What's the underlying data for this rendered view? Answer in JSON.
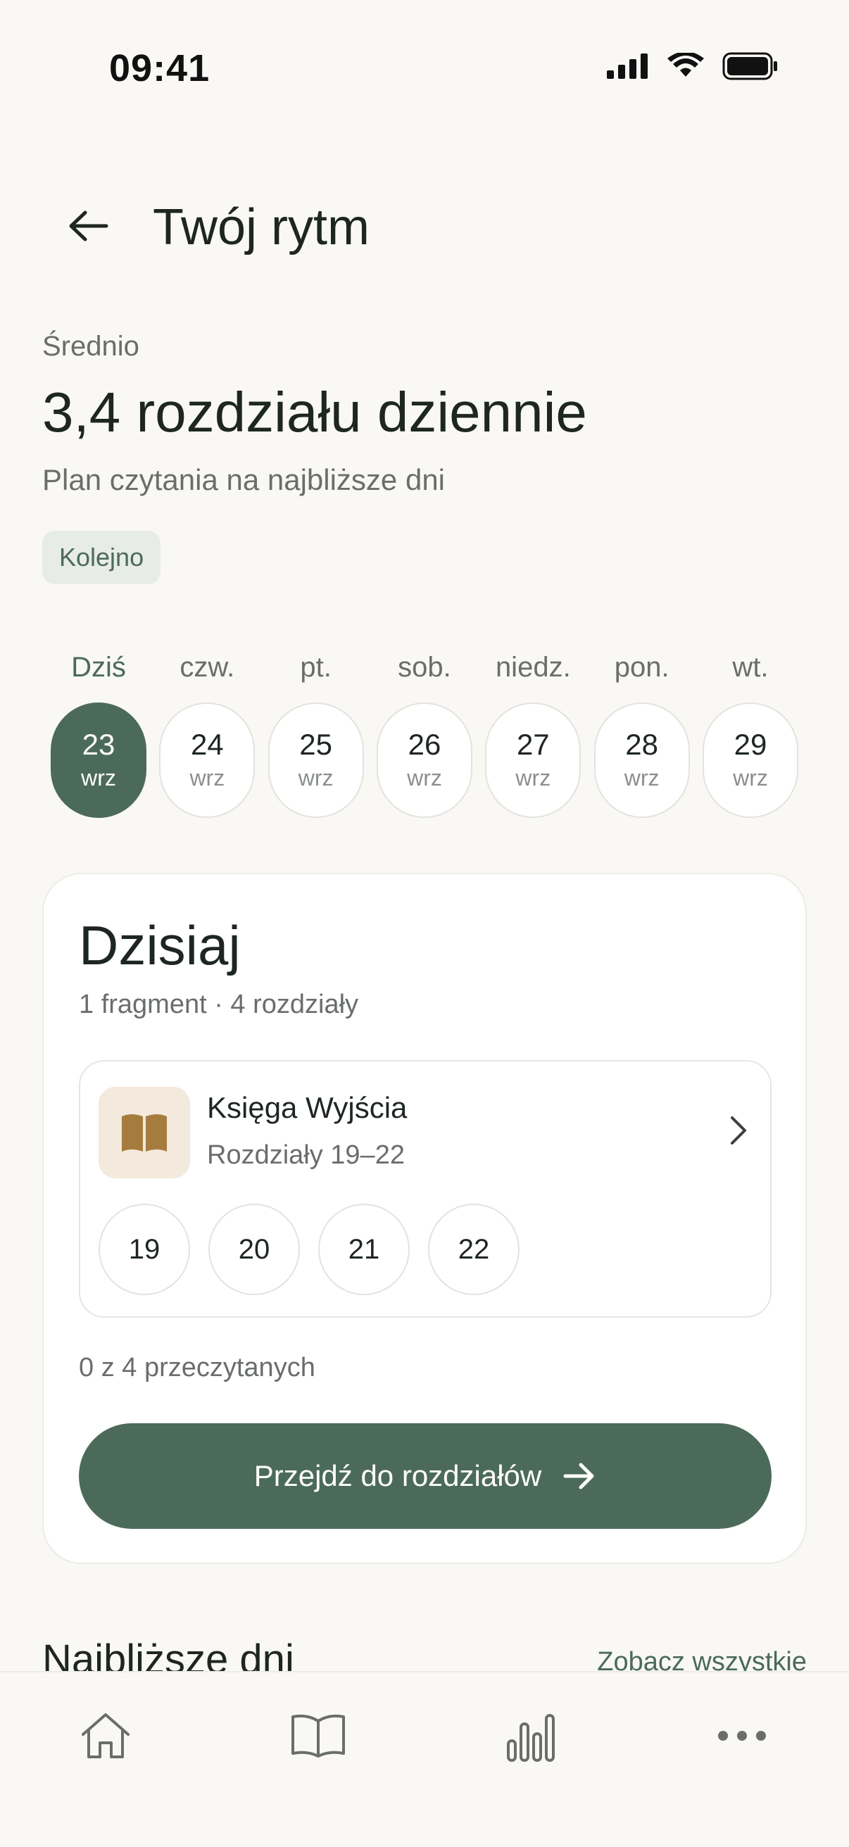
{
  "status_bar": {
    "time": "09:41"
  },
  "header": {
    "title": "Twój rytm"
  },
  "summary": {
    "label": "Średnio",
    "value": "3,4 rozdziału dziennie",
    "subtitle": "Plan czytania na najbliższe dni",
    "chip": "Kolejno"
  },
  "days": [
    {
      "name": "Dziś",
      "num": "23",
      "month": "wrz",
      "active": true
    },
    {
      "name": "czw.",
      "num": "24",
      "month": "wrz"
    },
    {
      "name": "pt.",
      "num": "25",
      "month": "wrz"
    },
    {
      "name": "sob.",
      "num": "26",
      "month": "wrz"
    },
    {
      "name": "niedz.",
      "num": "27",
      "month": "wrz"
    },
    {
      "name": "pon.",
      "num": "28",
      "month": "wrz"
    },
    {
      "name": "wt.",
      "num": "29",
      "month": "wrz"
    }
  ],
  "today": {
    "title": "Dzisiaj",
    "subtitle": "1 fragment · 4 rozdziały",
    "book": {
      "title": "Księga Wyjścia",
      "range": "Rozdziały 19–22",
      "chapters": [
        "19",
        "20",
        "21",
        "22"
      ]
    },
    "progress": "0 z 4 przeczytanych",
    "cta": "Przejdź do rozdziałów"
  },
  "upcoming": {
    "title": "Najbliższe dni",
    "link": "Zobacz wszystkie"
  },
  "colors": {
    "accent": "#4C6A5A",
    "background": "#F9F8F5",
    "book_icon": "#A67C3E"
  },
  "nav": {
    "items": [
      {
        "icon": "home-icon"
      },
      {
        "icon": "book-icon"
      },
      {
        "icon": "stats-icon"
      },
      {
        "icon": "more-icon"
      }
    ]
  }
}
